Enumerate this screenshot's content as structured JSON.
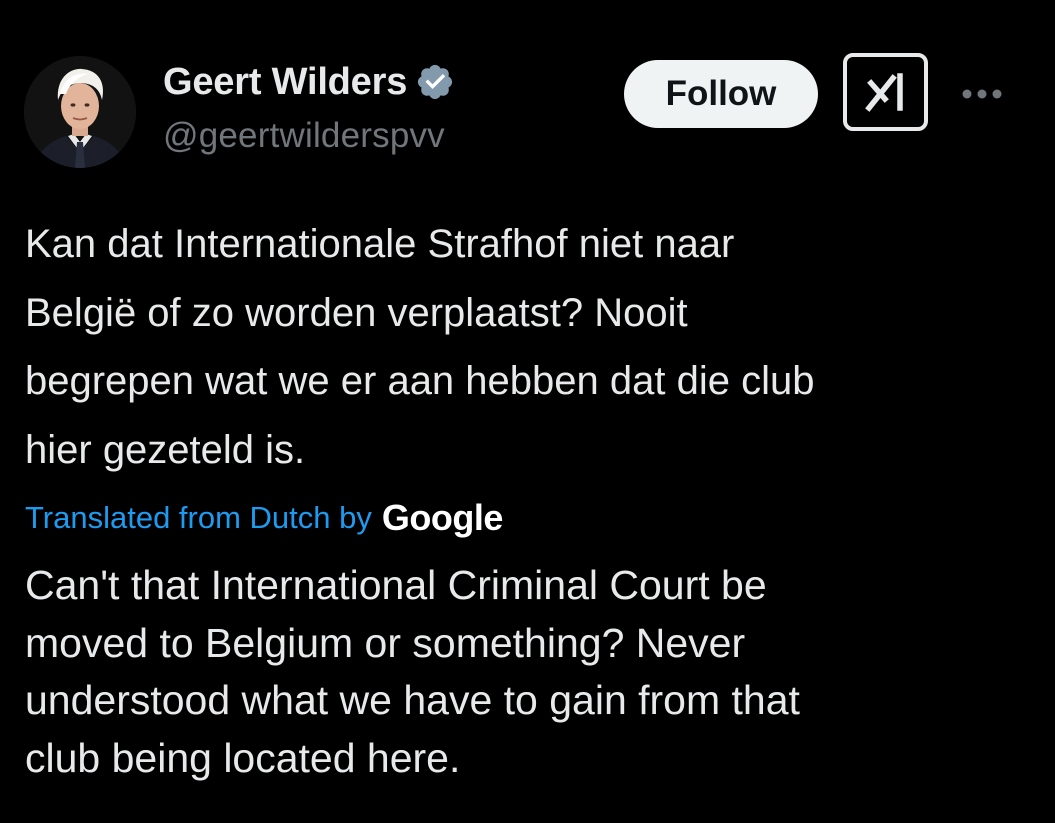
{
  "author": {
    "display_name": "Geert Wilders",
    "handle": "@geertwilderspvv",
    "verified": true,
    "avatar_icon": "profile-photo"
  },
  "actions": {
    "follow_label": "Follow",
    "grok_icon": "grok-icon",
    "more_icon": "more-options-icon"
  },
  "tweet": {
    "lines": [
      "Kan dat Internationale Strafhof niet naar",
      "België of zo worden verplaatst? Nooit",
      "begrepen wat we er aan hebben dat die club",
      "hier gezeteld is."
    ]
  },
  "translation": {
    "label": "Translated from Dutch by",
    "provider": "Google",
    "lines": [
      "Can't that International Criminal Court be",
      "moved to Belgium or something? Never",
      "understood what we have to gain from that",
      "club being located here."
    ]
  },
  "colors": {
    "background": "#000000",
    "primary_text": "#e7e9ea",
    "secondary_text": "#71767b",
    "link": "#1d9bf0",
    "verified_badge": "#829aab",
    "follow_button_bg": "#eff3f4"
  }
}
